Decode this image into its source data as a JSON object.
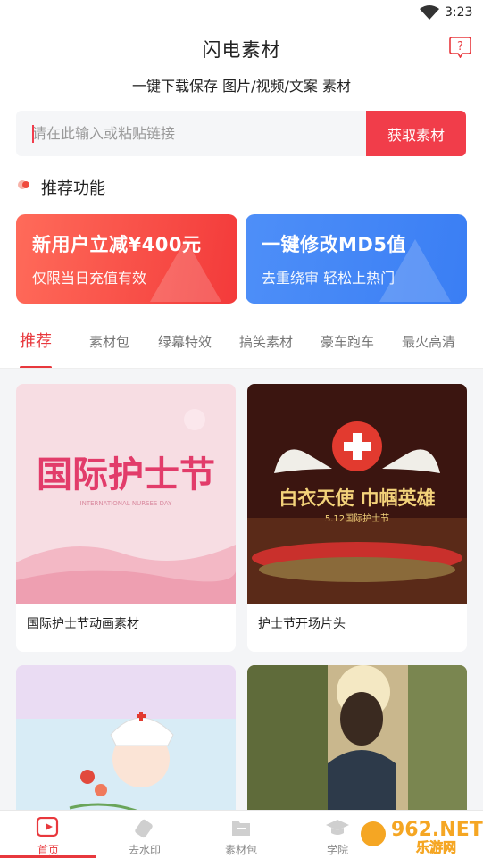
{
  "status_bar": {
    "time": "3:23"
  },
  "header": {
    "title": "闪电素材",
    "subtitle": "一键下载保存 图片/视频/文案 素材"
  },
  "search": {
    "placeholder": "请在此输入或粘贴链接",
    "button_label": "获取素材"
  },
  "recommend": {
    "title": "推荐功能"
  },
  "promos": [
    {
      "title": "新用户立减¥400元",
      "subtitle": "仅限当日充值有效",
      "color": "#f33a3a"
    },
    {
      "title": "一键修改MD5值",
      "subtitle": "去重绕审 轻松上热门",
      "color": "#3a7ef4"
    }
  ],
  "tabs": [
    "推荐",
    "素材包",
    "绿幕特效",
    "搞笑素材",
    "豪车跑车",
    "最火高清"
  ],
  "cards": [
    {
      "title": "国际护士节动画素材",
      "thumb_text": "国际护士节",
      "thumb_caption": "INTERNATIONAL NURSES DAY"
    },
    {
      "title": "护士节开场片头",
      "thumb_text": "白衣天使 巾帼英雄",
      "thumb_caption": "5.12国际护士节"
    },
    {
      "title": "",
      "thumb_text": ""
    },
    {
      "title": "",
      "thumb_text": ""
    }
  ],
  "bottom_nav": [
    {
      "label": "首页",
      "icon": "home-play-icon",
      "active": true
    },
    {
      "label": "去水印",
      "icon": "eraser-icon",
      "active": false
    },
    {
      "label": "素材包",
      "icon": "folder-icon",
      "active": false
    },
    {
      "label": "学院",
      "icon": "graduation-cap-icon",
      "active": false
    }
  ],
  "watermark": {
    "brand": "962.NET",
    "sub": "乐游网"
  },
  "colors": {
    "accent": "#e8383d",
    "blue": "#3a7ef4"
  }
}
